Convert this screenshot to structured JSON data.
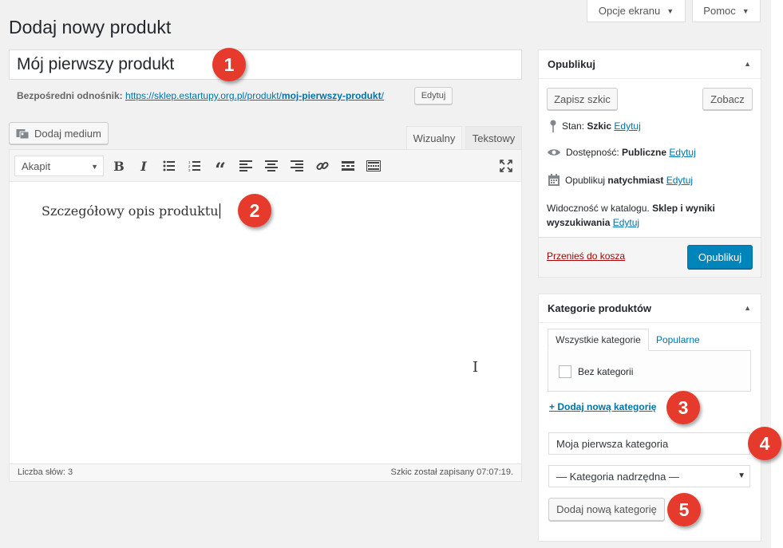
{
  "screen_options": "Opcje ekranu",
  "help": "Pomoc",
  "page_title": "Dodaj nowy produkt",
  "product_title": "Mój pierwszy produkt",
  "permalink": {
    "label": "Bezpośredni odnośnik:",
    "url_base": "https://sklep.estartupy.org.pl/produkt/",
    "slug": "moj-pierwszy-produkt",
    "url_end": "/",
    "edit": "Edytuj"
  },
  "editor": {
    "add_media": "Dodaj medium",
    "tab_visual": "Wizualny",
    "tab_text": "Tekstowy",
    "format_select": "Akapit",
    "content": "Szczegółowy opis produktu",
    "word_count": "Liczba słów: 3",
    "draft_saved": "Szkic został zapisany 07:07:19."
  },
  "publish": {
    "title": "Opublikuj",
    "save_draft": "Zapisz szkic",
    "preview": "Zobacz",
    "status_label": "Stan:",
    "status_value": "Szkic",
    "visibility_label": "Dostępność:",
    "visibility_value": "Publiczne",
    "schedule_label": "Opublikuj",
    "schedule_value": "natychmiast",
    "edit": "Edytuj",
    "catalog_label": "Widoczność w katalogu.",
    "catalog_value1": "Sklep i wyniki",
    "catalog_value2": "wyszukiwania",
    "trash": "Przenieś do kosza",
    "publish_button": "Opublikuj"
  },
  "categories": {
    "title": "Kategorie produktów",
    "tab_all": "Wszystkie kategorie",
    "tab_popular": "Popularne",
    "items": [
      "Bez kategorii"
    ],
    "add_new_link": "+ Dodaj nową kategorię",
    "new_category_value": "Moja pierwsza kategoria",
    "parent_select": "— Kategoria nadrzędna —",
    "add_button": "Dodaj nową kategorię"
  },
  "badges": [
    "1",
    "2",
    "3",
    "4",
    "5"
  ],
  "colors": {
    "badge": "#e53a2c",
    "primary_button": "#0085ba",
    "link": "#0073aa",
    "trash_link": "#a00"
  }
}
